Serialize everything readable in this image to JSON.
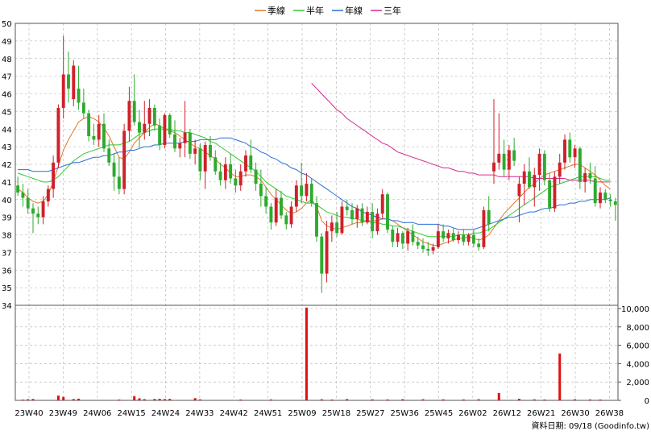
{
  "chart_data": {
    "type": "candlestick",
    "legend": [
      {
        "name": "季線",
        "color": "#e0782a"
      },
      {
        "name": "半年",
        "color": "#32c832"
      },
      {
        "name": "年線",
        "color": "#2a6fd6"
      },
      {
        "name": "三年",
        "color": "#d62a8c"
      }
    ],
    "price_axis": {
      "ylim": [
        34,
        50
      ],
      "ticks": [
        "34",
        "35",
        "36",
        "37",
        "38",
        "39",
        "40",
        "41",
        "42",
        "43",
        "44",
        "45",
        "46",
        "47",
        "48",
        "49",
        "50"
      ]
    },
    "volume_axis": {
      "ylim": [
        0,
        10000
      ],
      "ticks": [
        "0",
        "2,000",
        "4,000",
        "6,000",
        "8,000",
        "10,000"
      ]
    },
    "x_ticks": [
      "23W40",
      "23W49",
      "24W06",
      "24W15",
      "24W24",
      "24W33",
      "24W42",
      "24W51",
      "25W09",
      "25W18",
      "25W27",
      "25W36",
      "25W45",
      "26W02",
      "26W12",
      "26W21",
      "26W30",
      "26W38"
    ],
    "colors": {
      "up": "#d0202a",
      "down": "#2eaa2e",
      "volume": "#e01010",
      "grid": "#b0b0b0"
    },
    "candles": [
      [
        40.8,
        41.3,
        40.2,
        40.4
      ],
      [
        40.4,
        40.9,
        39.6,
        40.1
      ],
      [
        40.1,
        40.6,
        39.2,
        39.5
      ],
      [
        39.5,
        39.8,
        38.1,
        39.2
      ],
      [
        39.2,
        39.6,
        38.6,
        39.0
      ],
      [
        39.0,
        40.2,
        38.6,
        39.9
      ],
      [
        39.9,
        40.8,
        39.6,
        40.6
      ],
      [
        40.6,
        42.5,
        40.1,
        42.1
      ],
      [
        42.1,
        45.4,
        41.8,
        45.2
      ],
      [
        45.2,
        49.3,
        44.6,
        47.1
      ],
      [
        47.1,
        48.4,
        45.5,
        46.3
      ],
      [
        45.7,
        47.9,
        45.3,
        47.6
      ],
      [
        46.3,
        47.6,
        45.1,
        45.5
      ],
      [
        45.5,
        46.3,
        44.6,
        44.9
      ],
      [
        44.9,
        45.1,
        43.3,
        43.6
      ],
      [
        43.6,
        44.3,
        43.1,
        43.4
      ],
      [
        43.4,
        44.8,
        43.0,
        44.3
      ],
      [
        44.3,
        44.9,
        42.7,
        42.9
      ],
      [
        42.9,
        43.4,
        41.9,
        42.1
      ],
      [
        42.1,
        42.6,
        40.5,
        41.3
      ],
      [
        41.3,
        42.4,
        40.3,
        40.6
      ],
      [
        40.6,
        44.3,
        40.3,
        43.9
      ],
      [
        43.9,
        46.4,
        43.3,
        45.6
      ],
      [
        45.6,
        47.1,
        44.2,
        44.4
      ],
      [
        44.4,
        45.1,
        42.9,
        43.8
      ],
      [
        43.8,
        45.6,
        43.4,
        44.3
      ],
      [
        44.3,
        45.7,
        43.6,
        45.2
      ],
      [
        45.2,
        45.4,
        43.9,
        44.2
      ],
      [
        44.2,
        44.6,
        42.8,
        43.1
      ],
      [
        43.1,
        44.9,
        42.9,
        44.8
      ],
      [
        44.8,
        44.9,
        43.5,
        43.7
      ],
      [
        43.7,
        44.5,
        42.7,
        42.9
      ],
      [
        42.9,
        43.5,
        42.4,
        43.2
      ],
      [
        43.2,
        45.6,
        42.4,
        43.8
      ],
      [
        43.8,
        44.0,
        42.3,
        42.6
      ],
      [
        42.6,
        43.4,
        42.0,
        42.9
      ],
      [
        42.9,
        43.2,
        41.1,
        41.6
      ],
      [
        41.6,
        43.3,
        40.6,
        43.1
      ],
      [
        43.1,
        43.6,
        42.2,
        42.4
      ],
      [
        42.4,
        42.8,
        41.4,
        41.6
      ],
      [
        41.6,
        42.1,
        40.8,
        41.1
      ],
      [
        41.1,
        42.4,
        40.6,
        42.0
      ],
      [
        42.0,
        42.6,
        40.9,
        41.2
      ],
      [
        41.2,
        41.7,
        40.4,
        40.8
      ],
      [
        40.8,
        42.0,
        40.5,
        41.6
      ],
      [
        41.6,
        42.8,
        41.3,
        42.5
      ],
      [
        42.5,
        43.4,
        41.5,
        41.7
      ],
      [
        41.7,
        42.1,
        40.5,
        40.9
      ],
      [
        40.9,
        41.7,
        39.6,
        40.2
      ],
      [
        40.2,
        40.7,
        39.2,
        39.6
      ],
      [
        39.6,
        39.8,
        38.3,
        38.7
      ],
      [
        38.7,
        40.6,
        38.5,
        40.1
      ],
      [
        40.1,
        40.5,
        38.9,
        39.1
      ],
      [
        39.1,
        39.3,
        38.3,
        38.6
      ],
      [
        38.6,
        39.9,
        38.4,
        39.6
      ],
      [
        39.6,
        41.1,
        39.3,
        40.8
      ],
      [
        40.8,
        42.1,
        39.8,
        40.2
      ],
      [
        40.2,
        41.5,
        39.9,
        40.9
      ],
      [
        40.9,
        41.2,
        39.6,
        39.8
      ],
      [
        39.8,
        40.2,
        37.6,
        37.9
      ],
      [
        37.9,
        38.1,
        34.7,
        35.8
      ],
      [
        35.8,
        38.8,
        35.3,
        38.2
      ],
      [
        38.2,
        39.1,
        37.6,
        38.7
      ],
      [
        38.7,
        39.3,
        37.9,
        38.1
      ],
      [
        38.1,
        39.9,
        38.0,
        39.6
      ],
      [
        39.6,
        40.0,
        39.1,
        39.4
      ],
      [
        39.4,
        39.8,
        38.6,
        38.9
      ],
      [
        38.9,
        39.7,
        38.4,
        39.5
      ],
      [
        39.5,
        39.8,
        38.5,
        38.7
      ],
      [
        38.7,
        39.6,
        38.6,
        39.3
      ],
      [
        39.3,
        39.8,
        37.8,
        38.2
      ],
      [
        38.2,
        39.5,
        38.0,
        39.2
      ],
      [
        39.2,
        40.6,
        38.9,
        40.3
      ],
      [
        40.3,
        40.4,
        38.1,
        38.3
      ],
      [
        38.3,
        38.5,
        37.3,
        37.6
      ],
      [
        37.6,
        38.4,
        37.3,
        38.1
      ],
      [
        38.1,
        38.2,
        37.2,
        37.5
      ],
      [
        37.5,
        38.4,
        37.1,
        38.2
      ],
      [
        38.2,
        38.6,
        37.4,
        37.6
      ],
      [
        37.6,
        37.9,
        37.2,
        37.4
      ],
      [
        37.4,
        37.8,
        37.0,
        37.2
      ],
      [
        37.2,
        37.6,
        36.8,
        37.1
      ],
      [
        37.1,
        37.5,
        36.9,
        37.3
      ],
      [
        37.3,
        38.6,
        37.2,
        38.2
      ],
      [
        38.2,
        38.6,
        37.6,
        37.8
      ],
      [
        37.8,
        38.3,
        37.5,
        38.1
      ],
      [
        38.1,
        38.4,
        37.6,
        37.7
      ],
      [
        37.7,
        38.2,
        37.5,
        38.0
      ],
      [
        38.0,
        38.3,
        37.4,
        37.6
      ],
      [
        37.6,
        38.1,
        37.4,
        38.0
      ],
      [
        38.0,
        38.3,
        37.3,
        37.5
      ],
      [
        37.5,
        37.8,
        37.1,
        37.3
      ],
      [
        37.3,
        39.6,
        37.2,
        39.4
      ],
      [
        39.4,
        40.2,
        38.2,
        38.6
      ],
      [
        41.6,
        45.7,
        40.9,
        42.1
      ],
      [
        42.1,
        44.9,
        41.7,
        42.6
      ],
      [
        42.6,
        43.4,
        41.3,
        41.7
      ],
      [
        41.7,
        43.1,
        41.1,
        42.8
      ],
      [
        42.8,
        43.5,
        41.9,
        42.2
      ],
      [
        40.2,
        41.3,
        38.7,
        40.9
      ],
      [
        40.9,
        42.0,
        39.7,
        41.6
      ],
      [
        41.6,
        42.4,
        40.6,
        40.7
      ],
      [
        40.7,
        41.8,
        39.6,
        41.4
      ],
      [
        41.4,
        42.9,
        40.5,
        42.6
      ],
      [
        42.6,
        42.8,
        40.8,
        41.1
      ],
      [
        41.1,
        41.5,
        39.3,
        39.5
      ],
      [
        39.5,
        41.6,
        39.3,
        41.3
      ],
      [
        41.3,
        42.6,
        40.9,
        42.1
      ],
      [
        42.1,
        43.7,
        41.7,
        43.4
      ],
      [
        43.4,
        43.8,
        42.1,
        42.4
      ],
      [
        42.4,
        43.1,
        41.8,
        42.9
      ],
      [
        42.9,
        43.0,
        40.6,
        41.0
      ],
      [
        41.0,
        41.8,
        40.4,
        41.5
      ],
      [
        41.5,
        42.1,
        40.9,
        41.2
      ],
      [
        41.2,
        41.9,
        39.6,
        39.8
      ],
      [
        39.8,
        40.7,
        39.5,
        40.4
      ],
      [
        40.4,
        40.6,
        39.8,
        40.0
      ],
      [
        40.0,
        40.3,
        39.6,
        39.9
      ],
      [
        39.9,
        40.1,
        38.8,
        39.7
      ]
    ],
    "volume": [
      {
        "week_index": 1,
        "value": 80
      },
      {
        "week_index": 2,
        "value": 120
      },
      {
        "week_index": 3,
        "value": 150
      },
      {
        "week_index": 8,
        "value": 520
      },
      {
        "week_index": 9,
        "value": 380
      },
      {
        "week_index": 11,
        "value": 140
      },
      {
        "week_index": 12,
        "value": 180
      },
      {
        "week_index": 20,
        "value": 90
      },
      {
        "week_index": 23,
        "value": 460
      },
      {
        "week_index": 24,
        "value": 220
      },
      {
        "week_index": 25,
        "value": 130
      },
      {
        "week_index": 27,
        "value": 150
      },
      {
        "week_index": 28,
        "value": 170
      },
      {
        "week_index": 29,
        "value": 140
      },
      {
        "week_index": 30,
        "value": 160
      },
      {
        "week_index": 35,
        "value": 240
      },
      {
        "week_index": 36,
        "value": 110
      },
      {
        "week_index": 44,
        "value": 90
      },
      {
        "week_index": 50,
        "value": 100
      },
      {
        "week_index": 57,
        "value": 10100
      },
      {
        "week_index": 60,
        "value": 120
      },
      {
        "week_index": 62,
        "value": 90
      },
      {
        "week_index": 65,
        "value": 140
      },
      {
        "week_index": 70,
        "value": 110
      },
      {
        "week_index": 73,
        "value": 100
      },
      {
        "week_index": 76,
        "value": 130
      },
      {
        "week_index": 80,
        "value": 120
      },
      {
        "week_index": 84,
        "value": 110
      },
      {
        "week_index": 88,
        "value": 100
      },
      {
        "week_index": 91,
        "value": 120
      },
      {
        "week_index": 95,
        "value": 800
      },
      {
        "week_index": 99,
        "value": 170
      },
      {
        "week_index": 102,
        "value": 110
      },
      {
        "week_index": 104,
        "value": 90
      },
      {
        "week_index": 107,
        "value": 5100
      },
      {
        "week_index": 110,
        "value": 120
      },
      {
        "week_index": 113,
        "value": 100
      },
      {
        "week_index": 115,
        "value": 90
      }
    ],
    "quarter_line": [
      40.6,
      40.4,
      40.1,
      39.9,
      39.8,
      39.9,
      40.3,
      41.0,
      41.9,
      42.8,
      43.4,
      43.9,
      44.4,
      44.6,
      44.7,
      44.6,
      44.4,
      44.1,
      43.6,
      43.0,
      42.4,
      42.3,
      42.7,
      43.2,
      43.5,
      43.8,
      44.1,
      44.3,
      44.2,
      44.0,
      43.9,
      43.8,
      43.6,
      43.4,
      43.2,
      43.0,
      42.9,
      42.7,
      42.5,
      42.3,
      42.0,
      41.8,
      41.5,
      41.3,
      41.3,
      41.4,
      41.4,
      41.3,
      41.1,
      40.7,
      40.3,
      40.0,
      39.7,
      39.4,
      39.2,
      39.3,
      39.5,
      39.8,
      40.0,
      39.6,
      38.8,
      38.5,
      38.4,
      38.3,
      38.4,
      38.5,
      38.6,
      38.7,
      38.7,
      38.8,
      38.8,
      38.8,
      38.9,
      38.9,
      38.8,
      38.6,
      38.4,
      38.2,
      38.0,
      37.8,
      37.6,
      37.5,
      37.4,
      37.4,
      37.5,
      37.6,
      37.7,
      37.8,
      37.8,
      37.9,
      37.8,
      37.7,
      37.8,
      38.0,
      38.4,
      38.8,
      39.2,
      39.5,
      39.8,
      40.1,
      40.4,
      40.7,
      40.9,
      41.2,
      41.4,
      41.5,
      41.6,
      41.7,
      41.8,
      41.9,
      42.0,
      42.0,
      41.8,
      41.6,
      41.4,
      41.1,
      40.8,
      40.6
    ],
    "halfyear_line": [
      41.5,
      41.4,
      41.3,
      41.2,
      41.1,
      41.0,
      41.0,
      41.1,
      41.3,
      41.6,
      41.9,
      42.2,
      42.4,
      42.6,
      42.7,
      42.8,
      42.9,
      43.0,
      43.1,
      43.1,
      43.1,
      43.2,
      43.3,
      43.5,
      43.7,
      43.8,
      43.9,
      44.0,
      44.0,
      44.0,
      44.0,
      43.9,
      43.9,
      43.8,
      43.8,
      43.7,
      43.6,
      43.5,
      43.3,
      43.2,
      43.0,
      42.8,
      42.6,
      42.4,
      42.2,
      42.0,
      41.8,
      41.6,
      41.3,
      41.0,
      40.8,
      40.6,
      40.4,
      40.2,
      40.1,
      40.0,
      39.9,
      39.8,
      39.8,
      39.7,
      39.5,
      39.3,
      39.2,
      39.1,
      39.0,
      39.0,
      38.9,
      38.9,
      38.8,
      38.8,
      38.7,
      38.7,
      38.6,
      38.6,
      38.5,
      38.5,
      38.4,
      38.3,
      38.2,
      38.1,
      38.0,
      37.9,
      37.9,
      37.9,
      37.9,
      37.9,
      37.9,
      38.0,
      38.0,
      38.0,
      38.1,
      38.1,
      38.2,
      38.3,
      38.5,
      38.7,
      38.9,
      39.1,
      39.3,
      39.5,
      39.7,
      39.9,
      40.1,
      40.3,
      40.5,
      40.7,
      40.8,
      40.9,
      41.0,
      41.1,
      41.2,
      41.3,
      41.3,
      41.3,
      41.3,
      41.2,
      41.1,
      41.1
    ],
    "year_line": [
      41.7,
      41.7,
      41.7,
      41.6,
      41.6,
      41.6,
      41.6,
      41.7,
      41.8,
      41.9,
      42.0,
      42.1,
      42.1,
      42.2,
      42.3,
      42.4,
      42.4,
      42.5,
      42.5,
      42.6,
      42.7,
      42.7,
      42.8,
      42.8,
      42.9,
      43.0,
      43.0,
      43.1,
      43.1,
      43.2,
      43.2,
      43.2,
      43.2,
      43.3,
      43.3,
      43.3,
      43.4,
      43.4,
      43.4,
      43.4,
      43.5,
      43.5,
      43.5,
      43.4,
      43.3,
      43.2,
      43.0,
      42.9,
      42.7,
      42.6,
      42.4,
      42.3,
      42.1,
      42.0,
      41.8,
      41.7,
      41.5,
      41.4,
      41.2,
      41.0,
      40.8,
      40.6,
      40.4,
      40.2,
      40.0,
      39.8,
      39.6,
      39.5,
      39.3,
      39.2,
      39.1,
      39.0,
      38.9,
      38.9,
      38.8,
      38.8,
      38.7,
      38.7,
      38.7,
      38.6,
      38.6,
      38.6,
      38.6,
      38.6,
      38.5,
      38.5,
      38.4,
      38.3,
      38.3,
      38.3,
      38.3,
      38.4,
      38.5,
      38.6,
      38.7,
      38.8,
      38.9,
      39.0,
      39.0,
      39.1,
      39.2,
      39.3,
      39.3,
      39.4,
      39.5,
      39.5,
      39.6,
      39.7,
      39.7,
      39.8,
      39.8,
      39.9,
      39.9,
      40.0,
      40.0,
      40.0,
      40.0,
      40.1
    ],
    "three_year_line": [
      {
        "start_index": 58,
        "values": [
          46.6,
          46.3,
          46.0,
          45.7,
          45.4,
          45.1,
          44.9,
          44.6,
          44.4,
          44.2,
          44.0,
          43.8,
          43.6,
          43.4,
          43.2,
          43.1,
          42.9,
          42.7,
          42.6,
          42.5,
          42.4,
          42.3,
          42.2,
          42.1,
          42.0,
          41.9,
          41.8,
          41.8,
          41.7,
          41.6,
          41.6,
          41.5,
          41.5,
          41.4,
          41.4,
          41.4,
          41.4,
          41.3,
          41.3,
          41.3,
          41.3,
          41.3,
          41.3,
          41.3,
          41.2,
          41.2,
          41.2,
          41.2,
          41.2,
          41.2,
          41.2,
          41.1,
          41.1,
          41.1,
          41.1,
          41.1,
          41.0,
          41.0,
          41.0,
          41.0
        ]
      }
    ],
    "source_text": "資料日期: 09/18  (Goodinfo.tw)"
  }
}
